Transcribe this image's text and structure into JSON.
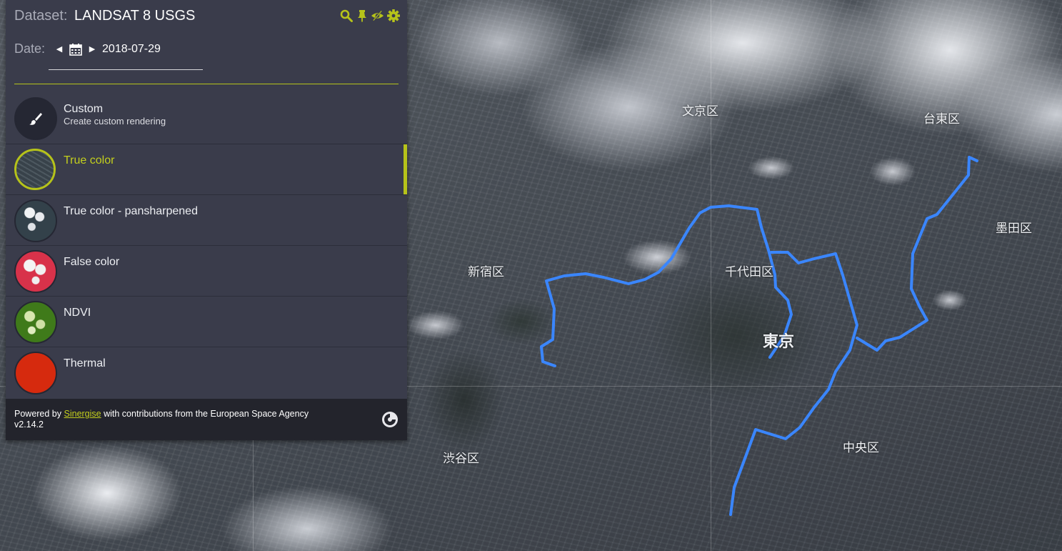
{
  "panel": {
    "dataset_label": "Dataset:",
    "dataset_value": "LANDSAT 8 USGS",
    "tools": [
      "search-icon",
      "pin-icon",
      "eye-toggle-icon",
      "gear-icon"
    ],
    "date_label": "Date:",
    "date_value": "2018-07-29",
    "accent_color": "#b6c31a",
    "layers": [
      {
        "name": "Custom",
        "description": "Create custom rendering",
        "active": false
      },
      {
        "name": "True color",
        "description": "",
        "active": true
      },
      {
        "name": "True color - pansharpened",
        "description": "",
        "active": false
      },
      {
        "name": "False color",
        "description": "",
        "active": false
      },
      {
        "name": "NDVI",
        "description": "",
        "active": false
      },
      {
        "name": "Thermal",
        "description": "",
        "active": false
      }
    ],
    "footer": {
      "powered_by": "Powered by",
      "sinergise_link": "Sinergise",
      "contribution": "with contributions from the European Space Agency",
      "version": "v2.14.2"
    }
  },
  "map": {
    "labels": {
      "bunkyo": "文京区",
      "taito": "台東区",
      "sumida": "墨田区",
      "shinjuku": "新宿区",
      "chiyoda": "千代田区",
      "tokyo": "東京",
      "shibuya": "渋谷区",
      "chuo": "中央区"
    },
    "route_color": "#3a86ff"
  }
}
